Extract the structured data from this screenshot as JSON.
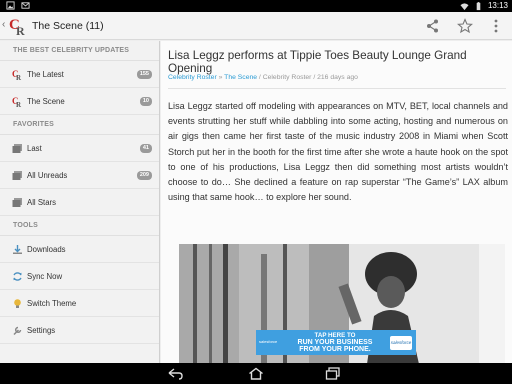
{
  "status_bar": {
    "time": "13:13"
  },
  "app_bar": {
    "title": "The Scene (11)"
  },
  "sidebar": {
    "section_updates": "THE BEST CELEBRITY UPDATES",
    "section_favorites": "FAVORITES",
    "section_tools": "TOOLS",
    "items": [
      {
        "label": "The Latest",
        "count": "155"
      },
      {
        "label": "The Scene",
        "count": "10"
      },
      {
        "label": "Last",
        "count": "41"
      },
      {
        "label": "All Unreads",
        "count": "209"
      },
      {
        "label": "All Stars",
        "count": ""
      },
      {
        "label": "Downloads",
        "count": ""
      },
      {
        "label": "Sync Now",
        "count": ""
      },
      {
        "label": "Switch Theme",
        "count": ""
      },
      {
        "label": "Settings",
        "count": ""
      }
    ]
  },
  "article": {
    "title": "Lisa Leggz performs at Tippie Toes Beauty Lounge Grand Opening",
    "meta": {
      "source": "Celebrity Roster",
      "sep1": " » ",
      "category": "The Scene",
      "sep2": " / Celebrity Roster / ",
      "age": "216 days ago"
    },
    "body": "Lisa Leggz started off modeling with appearances on MTV, BET, local channels and events strutting her stuff while dabbling into some acting, hosting and numerous on air gigs then came her first taste of the music industry 2008 in Miami when Scott Storch put her in the booth for the first time after she wrote a haute hook on the spot to one of his productions, Lisa Leggz then did something most artists wouldn’t choose to do… She declined a feature on rap superstar “The Game’s” LAX album using that same hook… to explore her sound."
  },
  "ad": {
    "line1": "TAP HERE TO",
    "line2": "RUN YOUR BUSINESS",
    "line3": "FROM YOUR PHONE.",
    "brand": "salesforce",
    "logo": "salesforce"
  }
}
